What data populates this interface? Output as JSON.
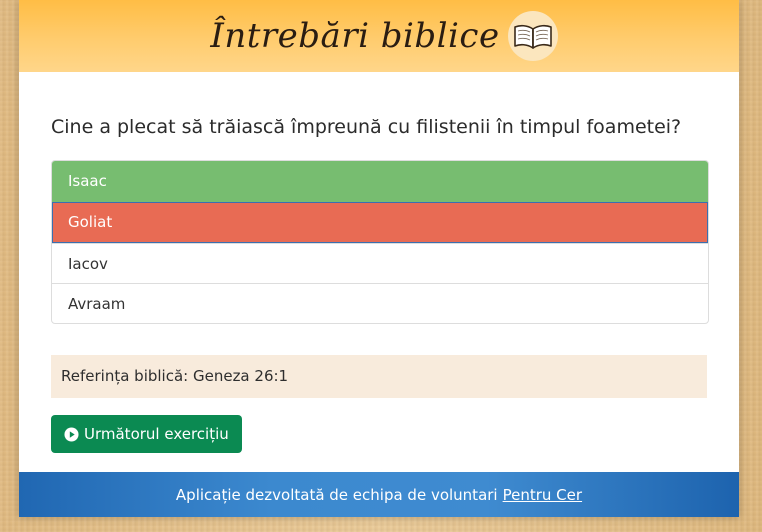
{
  "header": {
    "title": "Întrebări biblice",
    "icon": "open-book-icon"
  },
  "question": {
    "text": "Cine a plecat să trăiască împreună cu filistenii în timpul foametei?"
  },
  "answers": [
    {
      "label": "Isaac",
      "state": "correct"
    },
    {
      "label": "Goliat",
      "state": "wrong"
    },
    {
      "label": "Iacov",
      "state": "neutral"
    },
    {
      "label": "Avraam",
      "state": "neutral"
    }
  ],
  "reference": {
    "text": "Referința biblică: Geneza 26:1"
  },
  "next_button": {
    "label": "Următorul exercițiu",
    "icon": "play-circle-icon"
  },
  "footer": {
    "text": "Aplicație dezvoltată de echipa de voluntari",
    "link_text": "Pentru Cer"
  },
  "colors": {
    "correct": "#77bd70",
    "wrong": "#e86b54",
    "button": "#0b8a52",
    "footer": "#3c89cf",
    "header": "#ffc658"
  }
}
